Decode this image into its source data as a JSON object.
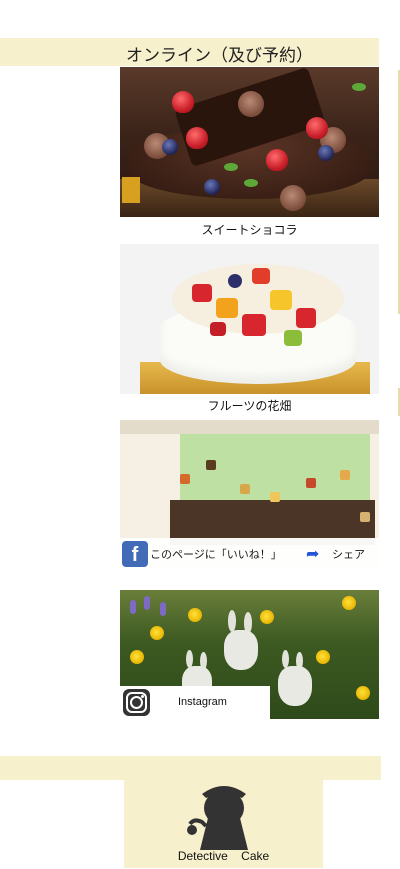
{
  "banner": {
    "title": "オンライン（及び予約）"
  },
  "products": [
    {
      "caption": "スイートショコラ"
    },
    {
      "caption": "フルーツの花畑"
    }
  ],
  "social": {
    "facebook": {
      "like_label": "このページに「いいね！」",
      "share_label": "シェア",
      "icon": "facebook-icon"
    },
    "instagram": {
      "label": "Instagram",
      "icon": "instagram-icon"
    }
  },
  "footer": {
    "logo_text": "Detective Cake",
    "icon": "detective-silhouette-icon"
  },
  "colors": {
    "band": "#f7f0cc",
    "facebook": "#3b66b6",
    "share_arrow": "#1b4fd6"
  }
}
